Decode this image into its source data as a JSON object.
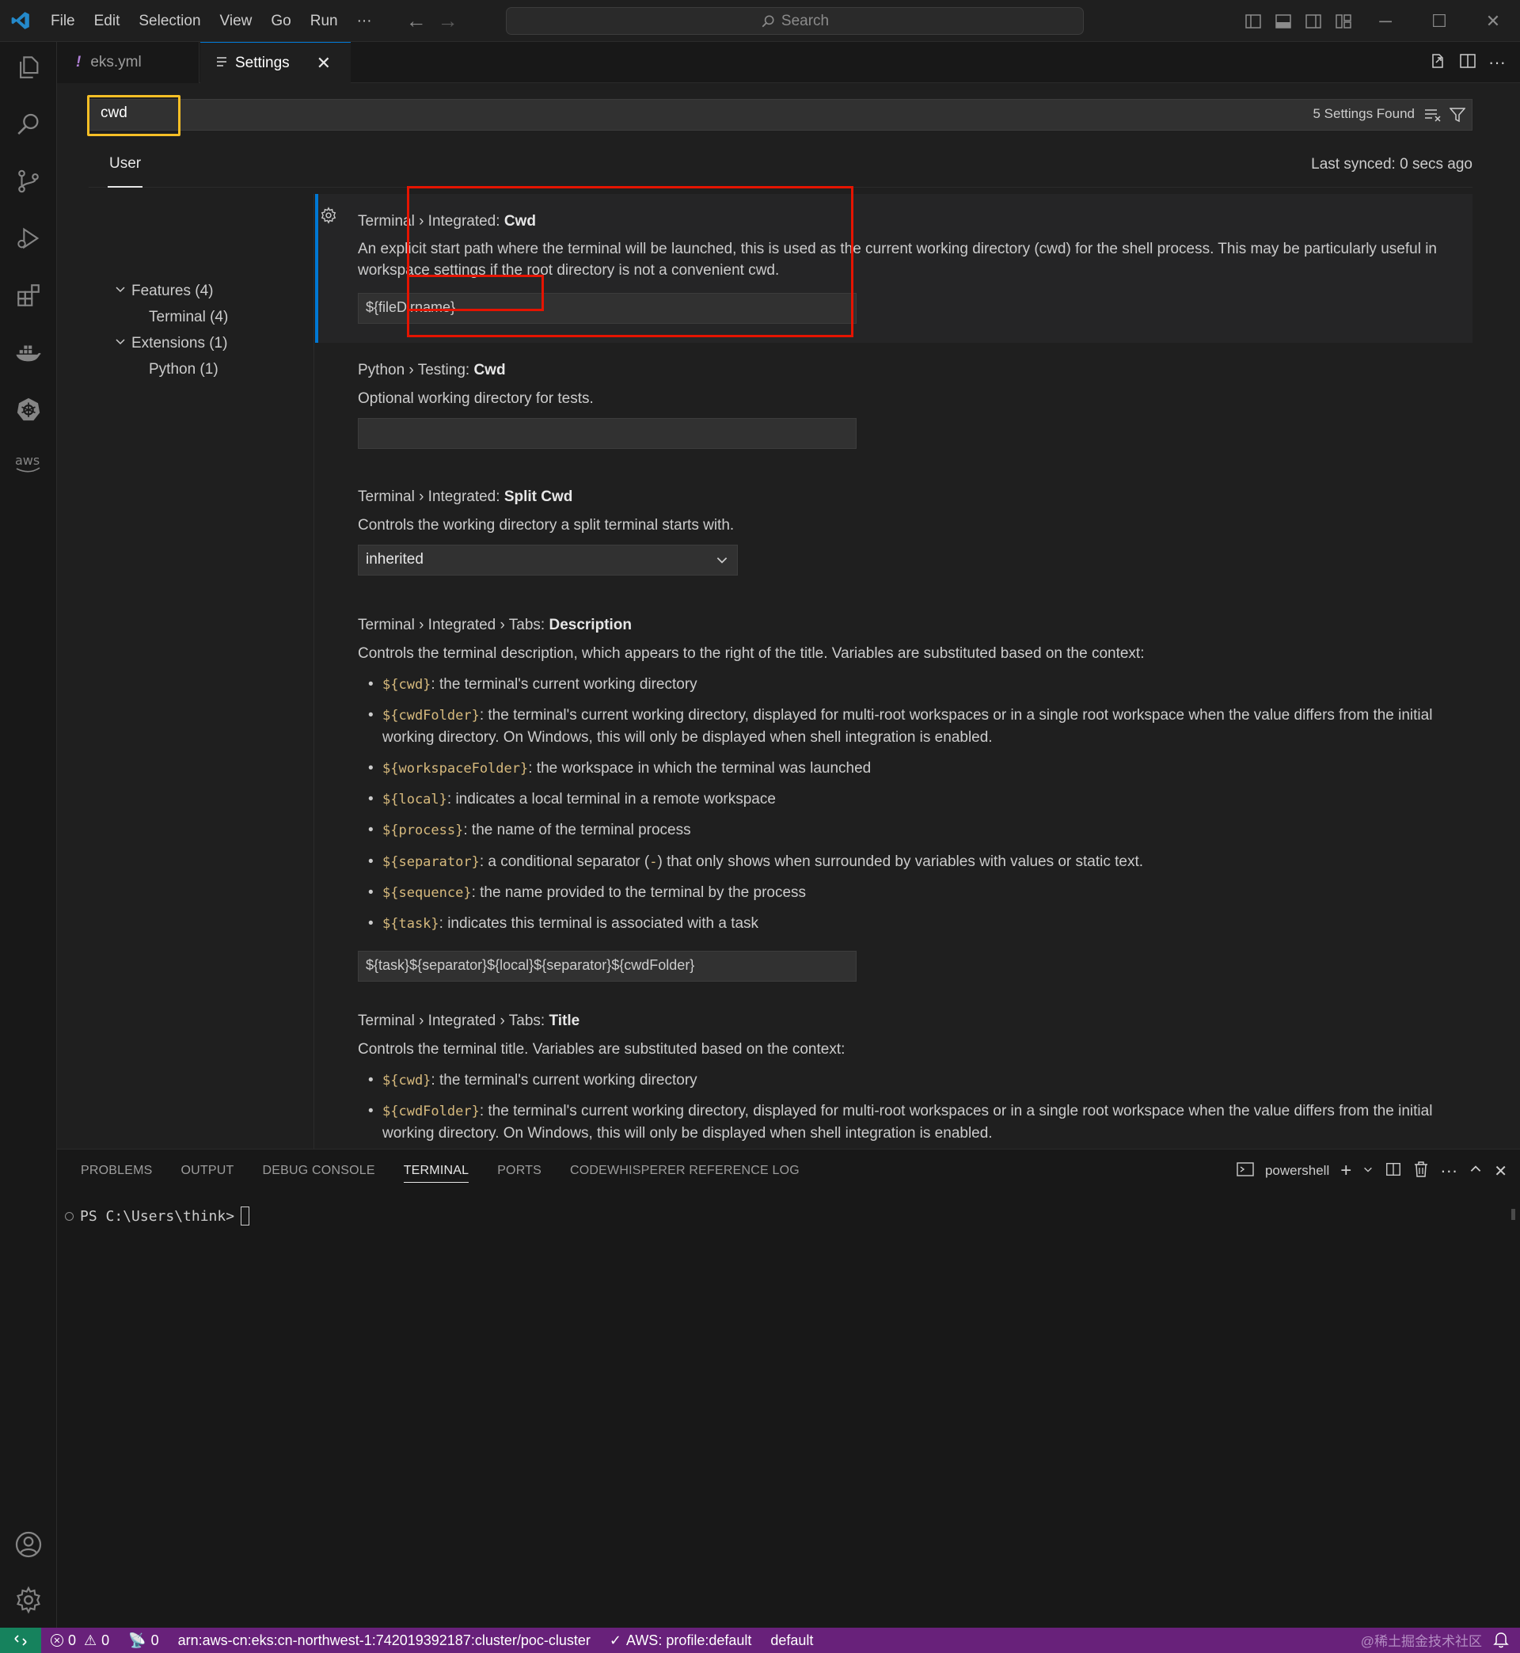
{
  "menu": [
    "File",
    "Edit",
    "Selection",
    "View",
    "Go",
    "Run",
    "···"
  ],
  "search_placeholder": "Search",
  "tabs": [
    {
      "label": "eks.yml",
      "badge": "!"
    },
    {
      "label": "Settings"
    }
  ],
  "settings": {
    "query": "cwd",
    "found": "5 Settings Found",
    "scope_tab": "User",
    "last_synced": "Last synced: 0 secs ago",
    "toc": [
      {
        "label": "Features (4)",
        "expanded": true
      },
      {
        "label": "Terminal (4)"
      },
      {
        "label": "Extensions (1)",
        "expanded": true
      },
      {
        "label": "Python (1)"
      }
    ],
    "items": [
      {
        "category": "Terminal › Integrated: ",
        "name": "Cwd",
        "description": "An explicit start path where the terminal will be launched, this is used as the current working directory (cwd) for the shell process. This may be particularly useful in workspace settings if the root directory is not a convenient cwd.",
        "value": "${fileDirname}"
      },
      {
        "category": "Python › Testing: ",
        "name": "Cwd",
        "description": "Optional working directory for tests.",
        "value": ""
      },
      {
        "category": "Terminal › Integrated: ",
        "name": "Split Cwd",
        "description": "Controls the working directory a split terminal starts with.",
        "value": "inherited"
      },
      {
        "category": "Terminal › Integrated › Tabs: ",
        "name": "Description",
        "description": "Controls the terminal description, which appears to the right of the title. Variables are substituted based on the context:",
        "bullets": [
          {
            "code": "${cwd}",
            "text": ": the terminal's current working directory"
          },
          {
            "code": "${cwdFolder}",
            "text": ": the terminal's current working directory, displayed for multi-root workspaces or in a single root workspace when the value differs from the initial working directory. On Windows, this will only be displayed when shell integration is enabled."
          },
          {
            "code": "${workspaceFolder}",
            "text": ": the workspace in which the terminal was launched"
          },
          {
            "code": "${local}",
            "text": ": indicates a local terminal in a remote workspace"
          },
          {
            "code": "${process}",
            "text": ": the name of the terminal process"
          },
          {
            "code": "${separator}",
            "text": ": a conditional separator (",
            "code2": "-",
            "text2": ") that only shows when surrounded by variables with values or static text."
          },
          {
            "code": "${sequence}",
            "text": ": the name provided to the terminal by the process"
          },
          {
            "code": "${task}",
            "text": ": indicates this terminal is associated with a task"
          }
        ],
        "value": "${task}${separator}${local}${separator}${cwdFolder}"
      },
      {
        "category": "Terminal › Integrated › Tabs: ",
        "name": "Title",
        "description": "Controls the terminal title. Variables are substituted based on the context:",
        "bullets": [
          {
            "code": "${cwd}",
            "text": ": the terminal's current working directory"
          },
          {
            "code": "${cwdFolder}",
            "text": ": the terminal's current working directory, displayed for multi-root workspaces or in a single root workspace when the value differs from the initial working directory. On Windows, this will only be displayed when shell integration is enabled."
          }
        ]
      }
    ]
  },
  "panel": {
    "tabs": [
      "PROBLEMS",
      "OUTPUT",
      "DEBUG CONSOLE",
      "TERMINAL",
      "PORTS",
      "CODEWHISPERER REFERENCE LOG"
    ],
    "active_tab": "TERMINAL",
    "shell": "powershell",
    "prompt": "PS C:\\Users\\think>"
  },
  "status": {
    "errors": "0",
    "warnings": "0",
    "ports": "0",
    "cluster": "arn:aws-cn:eks:cn-northwest-1:742019392187:cluster/poc-cluster",
    "aws_profile": "AWS: profile:default",
    "namespace": "default",
    "watermark": "@稀土掘金技术社区"
  },
  "colors": {
    "accent": "#0078d4",
    "statusbar": "#68217a",
    "remote": "#16825d",
    "highlight_yellow": "#f6bf26",
    "highlight_red": "#e51400",
    "code_text": "#d7ba7d"
  }
}
